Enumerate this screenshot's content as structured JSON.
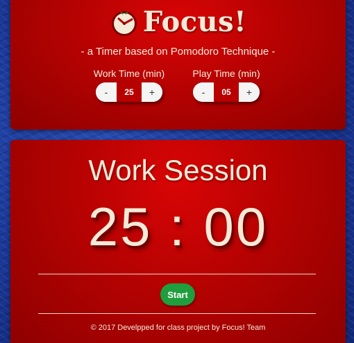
{
  "header": {
    "title": "Focus!",
    "subtitle": "- a Timer based on Pomodoro Technique -"
  },
  "settings": {
    "work": {
      "label": "Work Time (min)",
      "decrement": "-",
      "value": "25",
      "increment": "+"
    },
    "play": {
      "label": "Play Time (min)",
      "decrement": "-",
      "value": "05",
      "increment": "+"
    }
  },
  "session": {
    "title": "Work Session",
    "timer": "25 : 00",
    "start_label": "Start"
  },
  "footer": {
    "text": "©  2017 Develpped for class project by Focus! Team"
  },
  "colors": {
    "panel_red": "#b50202",
    "background_blue": "#1b3a9a",
    "start_green": "#1f9e3e",
    "text_cream": "#f3ead7"
  },
  "icons": {
    "logo": "tomato-clock-icon"
  }
}
